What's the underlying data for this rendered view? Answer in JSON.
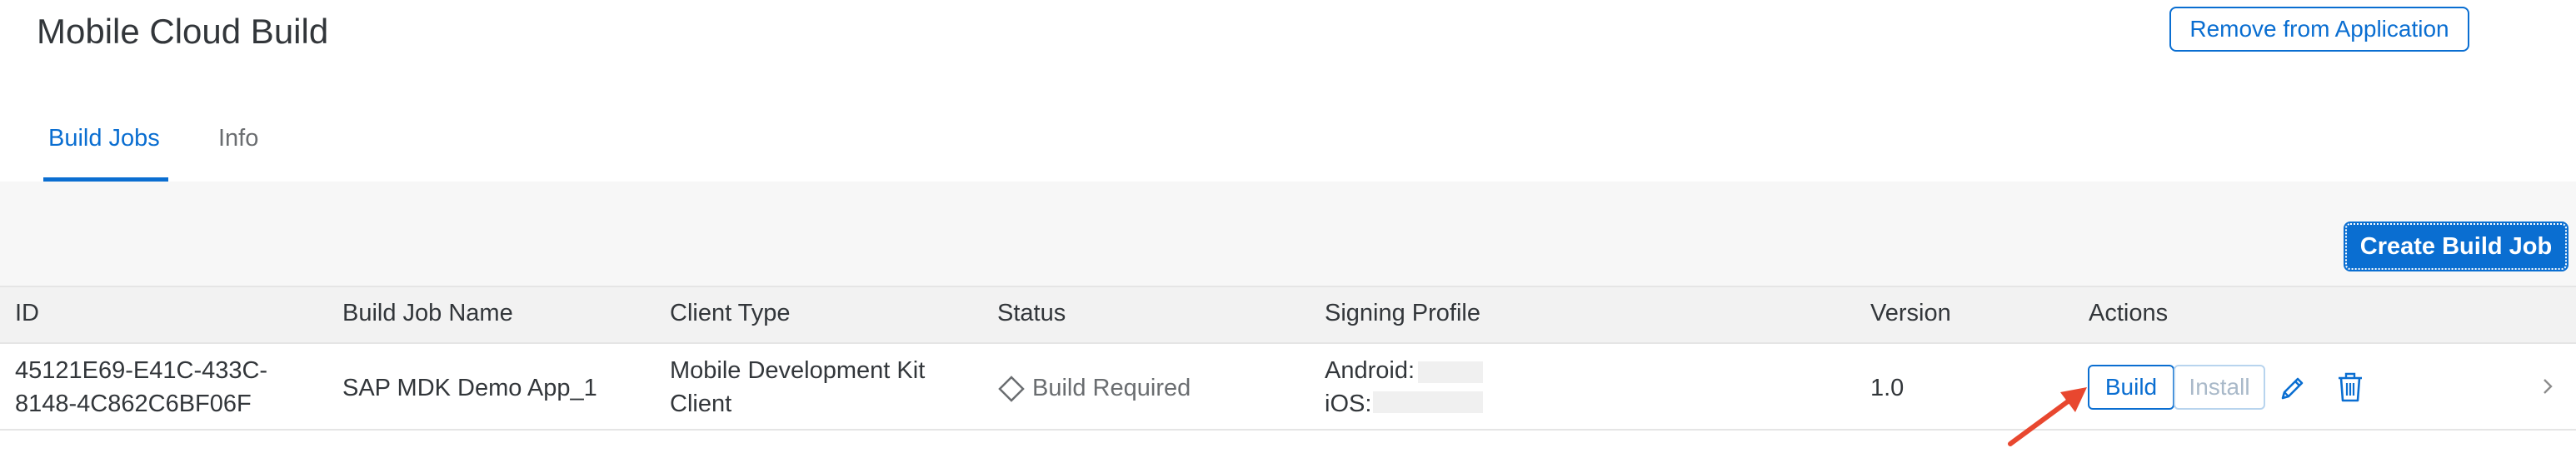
{
  "header": {
    "title": "Mobile Cloud Build",
    "remove_button": "Remove from Application"
  },
  "tabs": [
    {
      "label": "Build Jobs",
      "selected": true
    },
    {
      "label": "Info",
      "selected": false
    }
  ],
  "toolbar": {
    "create_button": "Create Build Job"
  },
  "table": {
    "columns": [
      "ID",
      "Build Job Name",
      "Client Type",
      "Status",
      "Signing Profile",
      "Version",
      "Actions"
    ],
    "rows": [
      {
        "id_line1": "45121E69-E41C-433C-",
        "id_line2": "8148-4C862C6BF06F",
        "name": "SAP MDK Demo App_1",
        "client_line1": "Mobile Development Kit",
        "client_line2": "Client",
        "status": "Build Required",
        "signing_android": "Android:",
        "signing_ios": "iOS:",
        "version": "1.0",
        "build_label": "Build",
        "install_label": "Install"
      }
    ]
  },
  "colors": {
    "accent": "#0a6ed1",
    "annotation_arrow": "#e8472f"
  },
  "icons": [
    "diamond-status-icon",
    "edit-pencil-icon",
    "delete-trash-icon",
    "chevron-right-icon",
    "annotation-arrow-icon"
  ]
}
